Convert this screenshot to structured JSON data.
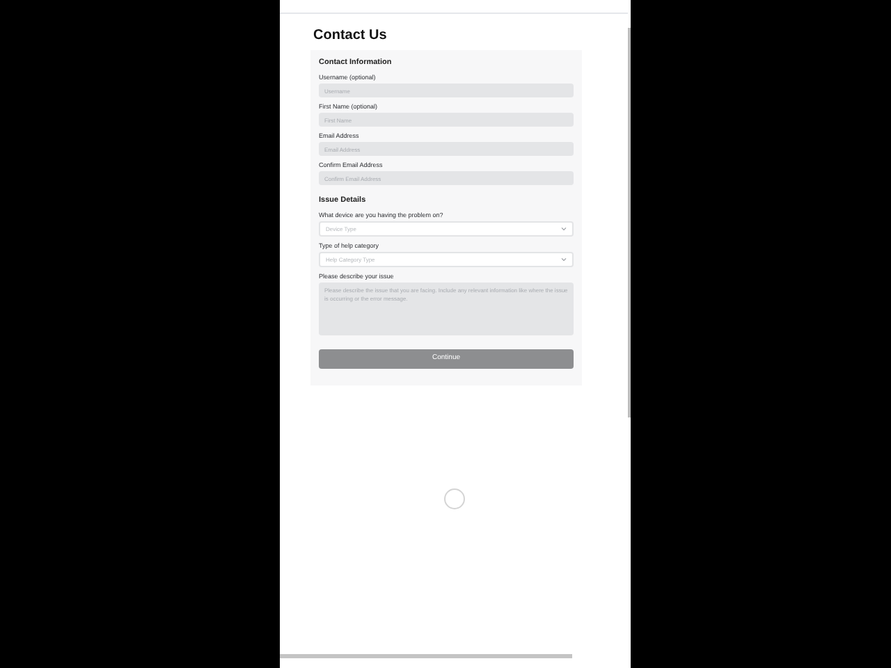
{
  "page": {
    "title": "Contact Us"
  },
  "sections": [
    {
      "heading": "Contact Information",
      "fields": [
        {
          "kind": "text",
          "label": "Username (optional)",
          "placeholder": "Username"
        },
        {
          "kind": "text",
          "label": "First Name (optional)",
          "placeholder": "First Name"
        },
        {
          "kind": "text",
          "label": "Email Address",
          "placeholder": "Email Address"
        },
        {
          "kind": "text",
          "label": "Confirm Email Address",
          "placeholder": "Confirm Email Address"
        }
      ]
    },
    {
      "heading": "Issue Details",
      "fields": [
        {
          "kind": "select",
          "label": "What device are you having the problem on?",
          "placeholder": "Device Type"
        },
        {
          "kind": "select",
          "label": "Type of help category",
          "placeholder": "Help Category Type"
        },
        {
          "kind": "textarea",
          "label": "Please describe your issue",
          "placeholder": "Please describe the issue that you are facing. Include any relevant information like where the issue is occurring or the error message."
        }
      ]
    }
  ],
  "submit": {
    "label": "Continue",
    "disabled": true
  },
  "loading": true
}
